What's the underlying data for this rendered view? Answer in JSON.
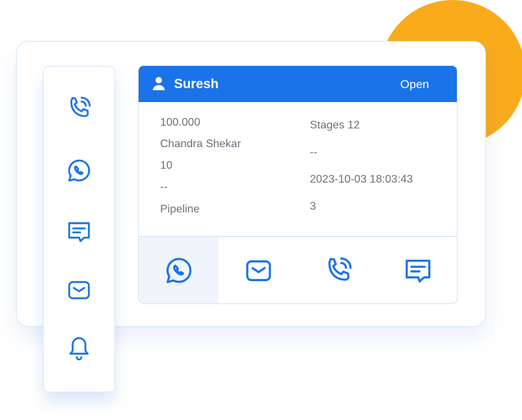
{
  "contact": {
    "name": "Suresh",
    "status": "Open"
  },
  "details_left": [
    "100.000",
    "Chandra Shekar",
    "10",
    "--",
    "Pipeline"
  ],
  "details_right": [
    "Stages 12",
    "--",
    "2023-10-03 18:03:43",
    "3"
  ],
  "sidebar_icons": [
    "phone-call-icon",
    "whatsapp-icon",
    "message-icon",
    "mail-icon",
    "bell-icon"
  ],
  "action_icons": [
    "whatsapp-icon",
    "mail-icon",
    "phone-call-icon",
    "message-icon"
  ],
  "colors": {
    "accent": "#1a73e8",
    "icon": "#1a73e8",
    "orange": "#f9ab1c",
    "text": "#6b6f78"
  }
}
